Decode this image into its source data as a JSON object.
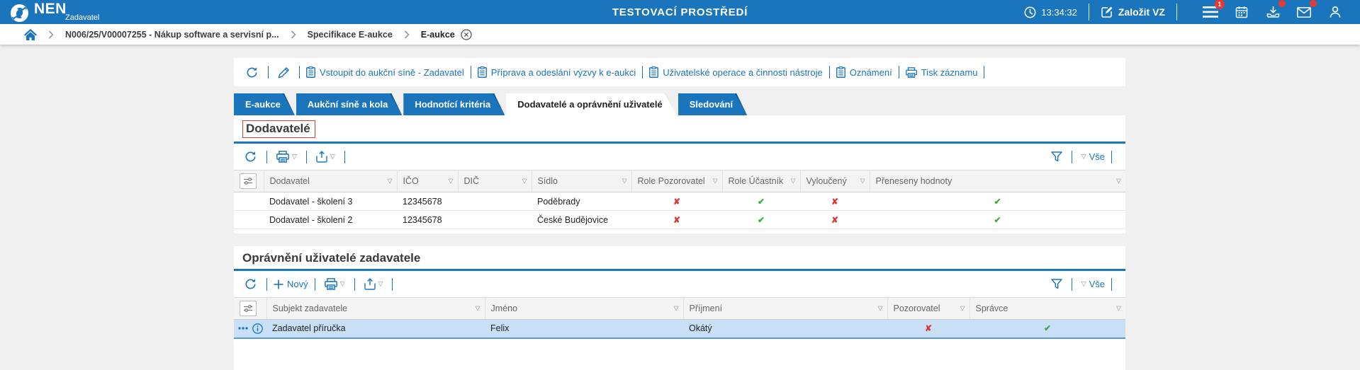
{
  "header": {
    "logo": "NEN",
    "logo_subtitle": "Zadavatel",
    "environment_title": "TESTOVACÍ PROSTŘEDÍ",
    "time": "13:34:32",
    "create_button": "Založit VZ",
    "menu_badge": "1"
  },
  "breadcrumb": {
    "items": [
      "N006/25/V00007255 - Nákup software a servisní p...",
      "Specifikace E-aukce",
      "E-aukce"
    ]
  },
  "actions": {
    "links": [
      "Vstoupit do aukční síně - Zadavatel",
      "Příprava a odeslání výzvy k e-aukci",
      "Uživatelské operace a činnosti nástroje",
      "Oznámení",
      "Tisk záznamu"
    ]
  },
  "tabs": [
    {
      "label": "E-aukce",
      "active": false
    },
    {
      "label": "Aukční síně a kola",
      "active": false
    },
    {
      "label": "Hodnotící kritéria",
      "active": false
    },
    {
      "label": "Dodavatelé a oprávnění uživatelé",
      "active": true
    },
    {
      "label": "Sledování",
      "active": false
    }
  ],
  "suppliers": {
    "title": "Dodavatelé",
    "all_label": "Vše",
    "columns": [
      "Dodavatel",
      "IČO",
      "DIČ",
      "Sídlo",
      "Role Pozorovatel",
      "Role Účastník",
      "Vyloučený",
      "Přeneseny hodnoty"
    ],
    "rows": [
      {
        "dodavatel": "Dodavatel - školení 3",
        "ico": "12345678",
        "dic": "",
        "sidlo": "Poděbrady",
        "role_pozorovatel": false,
        "role_ucastnik": true,
        "vylouceny": false,
        "preneseny_hodnoty": true
      },
      {
        "dodavatel": "Dodavatel - školení 2",
        "ico": "12345678",
        "dic": "",
        "sidlo": "České Budějovice",
        "role_pozorovatel": false,
        "role_ucastnik": true,
        "vylouceny": false,
        "preneseny_hodnoty": true
      }
    ]
  },
  "users": {
    "title": "Oprávnění uživatelé zadavatele",
    "new_label": "Nový",
    "all_label": "Vše",
    "columns": [
      "Subjekt zadavatele",
      "Jméno",
      "Příjmení",
      "Pozorovatel",
      "Správce"
    ],
    "rows": [
      {
        "subjekt": "Zadavatel příručka",
        "jmeno": "Felix",
        "prijmeni": "Okátý",
        "pozorovatel": false,
        "spravce": true,
        "selected": true
      }
    ]
  },
  "icons": {
    "check": "✔",
    "cross": "✘",
    "dropdown": "▽"
  },
  "colors": {
    "brand_blue": "#1b75bc",
    "badge_red": "#e53935",
    "check_green": "#3aad46",
    "cross_red": "#de3a35",
    "selected_row": "#c9dff5",
    "highlight_box": "#e03c31"
  }
}
